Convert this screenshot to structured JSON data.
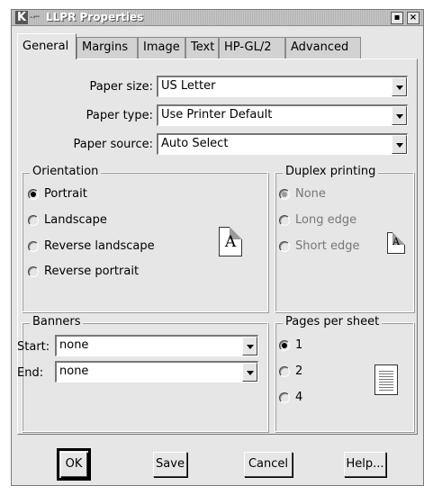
{
  "window": {
    "title": "LLPR Properties",
    "logo": "K",
    "pin": "-⌐",
    "buttons": [
      "▪",
      "×"
    ]
  },
  "tabs": [
    "General",
    "Margins",
    "Image",
    "Text",
    "HP-GL/2",
    "Advanced"
  ],
  "fields": {
    "paper_size": {
      "label": "Paper size:",
      "value": "US Letter"
    },
    "paper_type": {
      "label": "Paper type:",
      "value": "Use Printer Default"
    },
    "paper_source": {
      "label": "Paper source:",
      "value": "Auto Select"
    }
  },
  "orientation": {
    "title": "Orientation",
    "options": [
      "Portrait",
      "Landscape",
      "Reverse landscape",
      "Reverse portrait"
    ],
    "selected": 0,
    "preview_letter": "A"
  },
  "duplex": {
    "title": "Duplex printing",
    "options": [
      "None",
      "Long edge",
      "Short edge"
    ],
    "selected": 0,
    "preview_letter": "A"
  },
  "banners": {
    "title": "Banners",
    "start_label": "Start:",
    "start_value": "none",
    "end_label": "End:",
    "end_value": "none"
  },
  "pages_per_sheet": {
    "title": "Pages per sheet",
    "options": [
      "1",
      "2",
      "4"
    ],
    "selected": 0
  },
  "buttons": {
    "ok": "OK",
    "save": "Save",
    "cancel": "Cancel",
    "help": "Help..."
  }
}
